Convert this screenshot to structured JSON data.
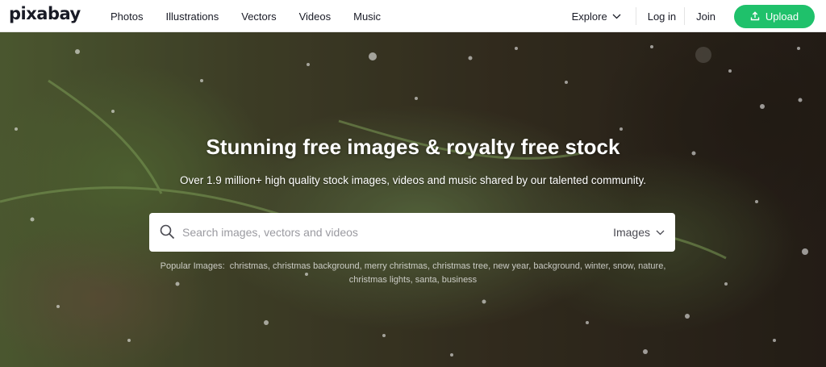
{
  "header": {
    "logo": "pixabay",
    "nav": [
      {
        "label": "Photos"
      },
      {
        "label": "Illustrations"
      },
      {
        "label": "Vectors"
      },
      {
        "label": "Videos"
      },
      {
        "label": "Music"
      }
    ],
    "explore_label": "Explore",
    "login_label": "Log in",
    "join_label": "Join",
    "upload_label": "Upload"
  },
  "hero": {
    "title": "Stunning free images & royalty free stock",
    "subtitle": "Over 1.9 million+ high quality stock images, videos and music shared by our talented community.",
    "search": {
      "placeholder": "Search images, vectors and videos",
      "value": "",
      "type_selected": "Images"
    },
    "popular": {
      "label": "Popular Images:",
      "terms": [
        "christmas",
        "christmas background",
        "merry christmas",
        "christmas tree",
        "new year",
        "background",
        "winter",
        "snow",
        "nature",
        "christmas lights",
        "santa",
        "business"
      ]
    }
  },
  "colors": {
    "accent": "#1fc16b",
    "text_dark": "#191b26"
  },
  "icons": {
    "search": "search-icon",
    "upload": "upload-icon",
    "chevron": "chevron-down-icon"
  }
}
